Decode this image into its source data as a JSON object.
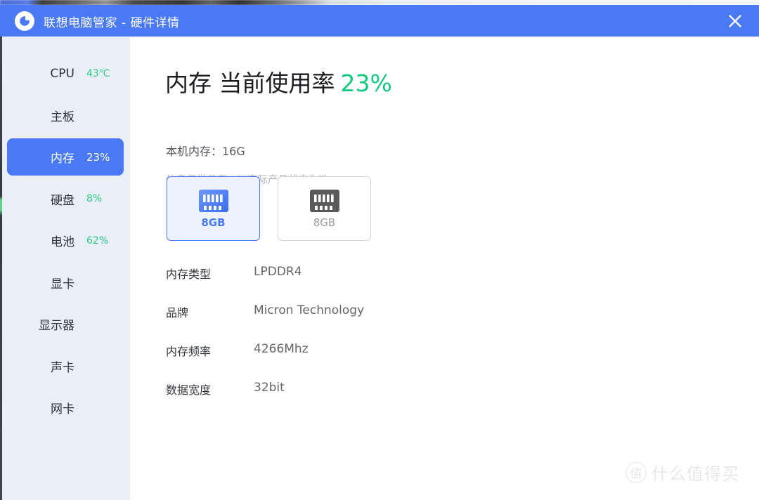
{
  "window": {
    "title": "联想电脑管家 - 硬件详情",
    "logo_icon": "lenovo-l-logo-icon",
    "close_icon": "close-icon",
    "titlebar_color": "#4A79F5"
  },
  "sidebar": {
    "background_color": "#E9EEF7",
    "selected_color": "#4A79F5",
    "value_color": "#2ECB82",
    "items": [
      {
        "label": "CPU",
        "value": "43℃",
        "selected": false
      },
      {
        "label": "主板",
        "value": "",
        "selected": false
      },
      {
        "label": "内存",
        "value": "23%",
        "selected": true
      },
      {
        "label": "硬盘",
        "value": "8%",
        "selected": false
      },
      {
        "label": "电池",
        "value": "62%",
        "selected": false
      },
      {
        "label": "显卡",
        "value": "",
        "selected": false
      },
      {
        "label": "显示器",
        "value": "",
        "selected": false
      },
      {
        "label": "声卡",
        "value": "",
        "selected": false
      },
      {
        "label": "网卡",
        "value": "",
        "selected": false
      }
    ]
  },
  "main": {
    "headline_prefix": "内存 当前使用率",
    "headline_percent": "23%",
    "headline_percent_color": "#0FC97D",
    "total_memory_line": "本机内存：16G",
    "disclaimer": "信息仅供参考，以实际产品状态为准。",
    "slots": [
      {
        "capacity": "8GB",
        "icon": "ram-module-icon",
        "selected": true
      },
      {
        "capacity": "8GB",
        "icon": "ram-module-icon",
        "selected": false
      }
    ],
    "specs": [
      {
        "key": "内存类型",
        "value": "LPDDR4"
      },
      {
        "key": "品牌",
        "value": "Micron Technology"
      },
      {
        "key": "内存频率",
        "value": "4266Mhz"
      },
      {
        "key": "数据宽度",
        "value": "32bit"
      }
    ]
  },
  "watermark": {
    "logo_char": "值",
    "text": "什么值得买"
  }
}
